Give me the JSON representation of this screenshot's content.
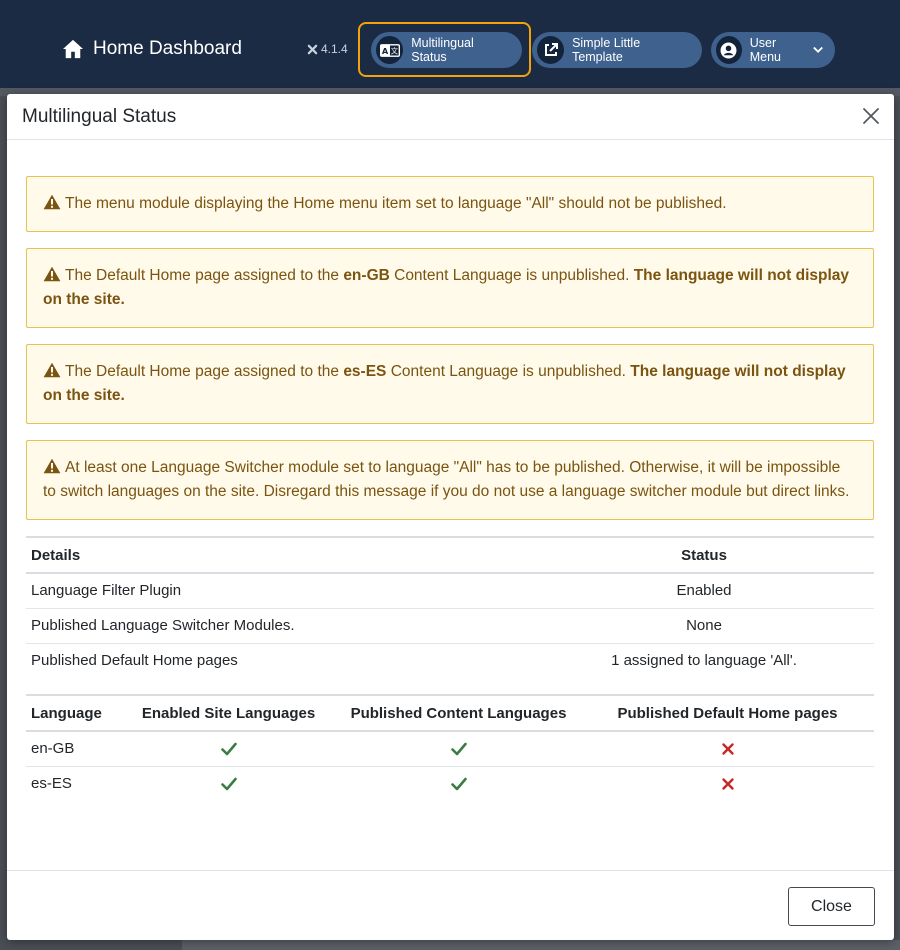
{
  "header": {
    "home_label": "Home Dashboard",
    "version": "4.1.4",
    "multilingual_label": "Multilingual Status",
    "template_label": "Simple Little Template",
    "user_menu_label": "User Menu"
  },
  "modal": {
    "title": "Multilingual Status",
    "alerts": [
      {
        "text": "The menu module displaying the Home menu item set to language \"All\" should not be published."
      },
      {
        "pre": "The Default Home page assigned to the ",
        "code": "en-GB",
        "mid": " Content Language is unpublished. ",
        "strong": "The language will not display on the site."
      },
      {
        "pre": "The Default Home page assigned to the ",
        "code": "es-ES",
        "mid": " Content Language is unpublished. ",
        "strong": "The language will not display on the site."
      },
      {
        "text": "At least one Language Switcher module set to language \"All\" has to be published. Otherwise, it will be impossible to switch languages on the site. Disregard this message if you do not use a language switcher module but direct links."
      }
    ],
    "details_table": {
      "headers": [
        "Details",
        "Status"
      ],
      "rows": [
        [
          "Language Filter Plugin",
          "Enabled"
        ],
        [
          "Published Language Switcher Modules.",
          "None"
        ],
        [
          "Published Default Home pages",
          "1 assigned to language 'All'."
        ]
      ]
    },
    "language_table": {
      "headers": [
        "Language",
        "Enabled Site Languages",
        "Published Content Languages",
        "Published Default Home pages"
      ],
      "rows": [
        {
          "language": "en-GB",
          "site_enabled": "check-icon",
          "content_published": "check-icon",
          "home_published": "cross-icon"
        },
        {
          "language": "es-ES",
          "site_enabled": "check-icon",
          "content_published": "check-icon",
          "home_published": "cross-icon"
        }
      ]
    },
    "close_label": "Close"
  },
  "colors": {
    "header_bg": "#1b2b44",
    "pill_bg": "#3f618e",
    "focus": "#f2a20c",
    "alert_bg": "#fffaea",
    "alert_border": "#e8c251",
    "alert_text": "#7a5410",
    "check": "#3a7d44",
    "cross": "#c52827"
  }
}
